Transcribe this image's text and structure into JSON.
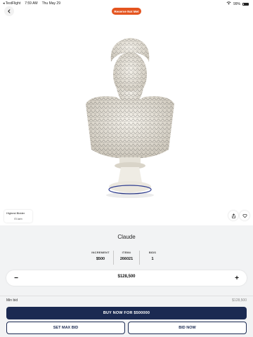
{
  "status_bar": {
    "carrier": "◂ TestFlight",
    "time": "7:59 AM",
    "date": "Thu May 29",
    "battery": "99%"
  },
  "header": {
    "back_icon": "chevron-left-icon",
    "reserve_badge": "Reserve Not Met",
    "reserve_color": "#e4541f"
  },
  "bidder": {
    "title": "Highest Bidder",
    "name": "El.larb"
  },
  "actions": {
    "share_icon": "share-icon",
    "favorite_icon": "heart-icon"
  },
  "item": {
    "title": "Claude",
    "stats": [
      {
        "label": "INCREMENT",
        "value": "$500"
      },
      {
        "label": "ITEM#",
        "value": "266021"
      },
      {
        "label": "BIDS",
        "value": "1"
      }
    ]
  },
  "bid_stepper": {
    "minus": "−",
    "value": "$128,500",
    "plus": "+"
  },
  "min_bid": {
    "label": "Min bid",
    "value": "$128,500"
  },
  "buttons": {
    "buy_now": "BUY NOW FOR $500000",
    "set_max_bid": "SET MAX BID",
    "bid_now": "BID NOW",
    "primary_color": "#1b2a52"
  }
}
